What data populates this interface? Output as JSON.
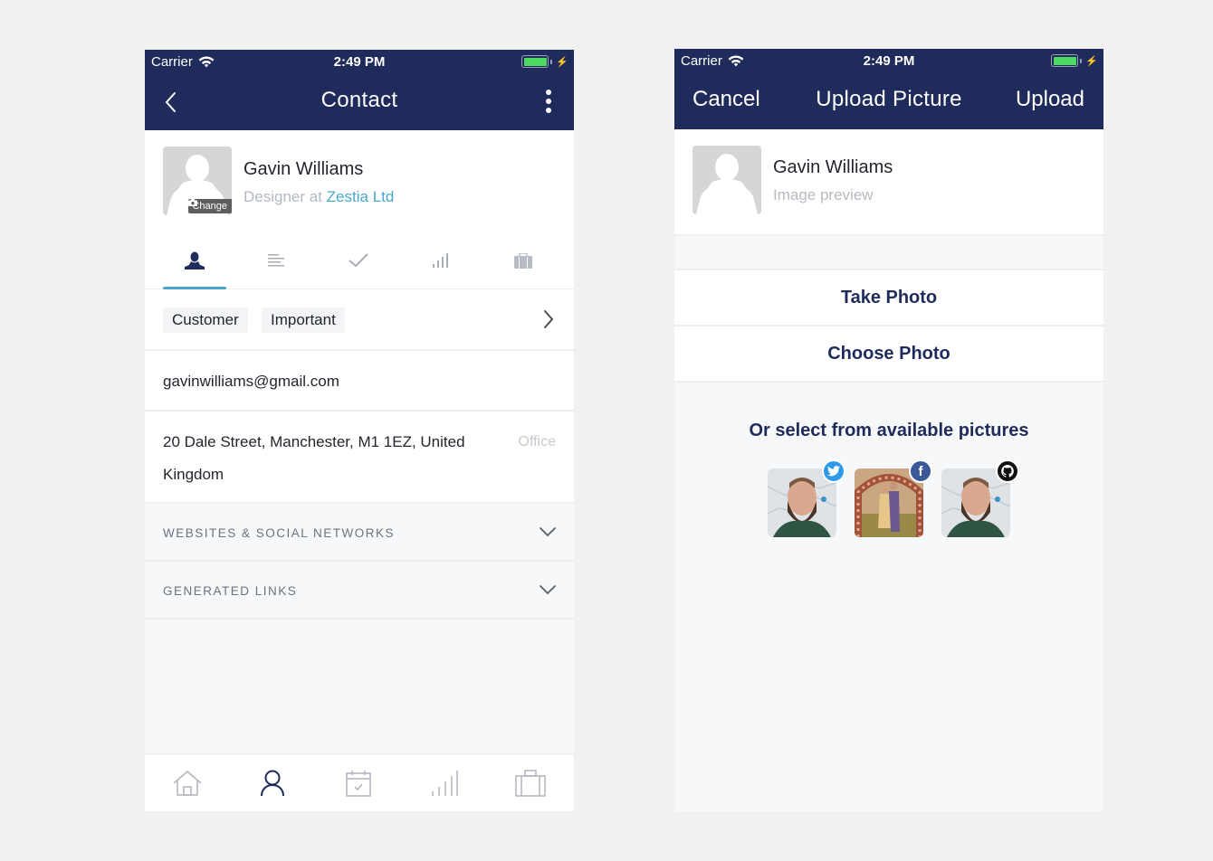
{
  "colors": {
    "header_bg": "#1f2b5a",
    "accent": "#4aa7c9",
    "link": "#47a9cc",
    "twitter": "#2f9be8",
    "facebook": "#3b5998",
    "github": "#111111"
  },
  "contact_screen": {
    "status_bar": {
      "carrier": "Carrier",
      "time": "2:49 PM",
      "battery_percent": 100,
      "charging": true
    },
    "nav": {
      "title": "Contact",
      "back_icon": "chevron-left-icon",
      "more_icon": "more-vertical-icon"
    },
    "profile": {
      "name": "Gavin Williams",
      "role_prefix": "Designer at ",
      "company": "Zestia Ltd",
      "change_label": "Change"
    },
    "tabs": [
      {
        "icon": "person-icon",
        "active": true
      },
      {
        "icon": "notes-icon",
        "active": false
      },
      {
        "icon": "check-icon",
        "active": false
      },
      {
        "icon": "bar-chart-icon",
        "active": false
      },
      {
        "icon": "briefcase-icon",
        "active": false
      }
    ],
    "tags": [
      "Customer",
      "Important"
    ],
    "email": "gavinwilliams@gmail.com",
    "address": {
      "text": "20 Dale Street, Manchester, M1 1EZ, United Kingdom",
      "label": "Office"
    },
    "sections": [
      {
        "label": "WEBSITES & SOCIAL NETWORKS",
        "expanded": false
      },
      {
        "label": "GENERATED LINKS",
        "expanded": false
      }
    ],
    "bottom_nav": [
      {
        "icon": "home-icon",
        "active": false
      },
      {
        "icon": "person-icon",
        "active": true
      },
      {
        "icon": "calendar-icon",
        "active": false
      },
      {
        "icon": "signal-chart-icon",
        "active": false
      },
      {
        "icon": "briefcase-icon",
        "active": false
      }
    ]
  },
  "upload_screen": {
    "status_bar": {
      "carrier": "Carrier",
      "time": "2:49 PM",
      "battery_percent": 100,
      "charging": true
    },
    "nav": {
      "cancel": "Cancel",
      "title": "Upload Picture",
      "upload": "Upload"
    },
    "profile": {
      "name": "Gavin Williams",
      "subtitle": "Image preview"
    },
    "actions": {
      "take_photo": "Take Photo",
      "choose_photo": "Choose Photo"
    },
    "available_heading": "Or select from available pictures",
    "available_pictures": [
      {
        "source": "Twitter",
        "badge_icon": "twitter-icon"
      },
      {
        "source": "Facebook",
        "badge_icon": "facebook-icon"
      },
      {
        "source": "GitHub",
        "badge_icon": "github-icon"
      }
    ]
  }
}
